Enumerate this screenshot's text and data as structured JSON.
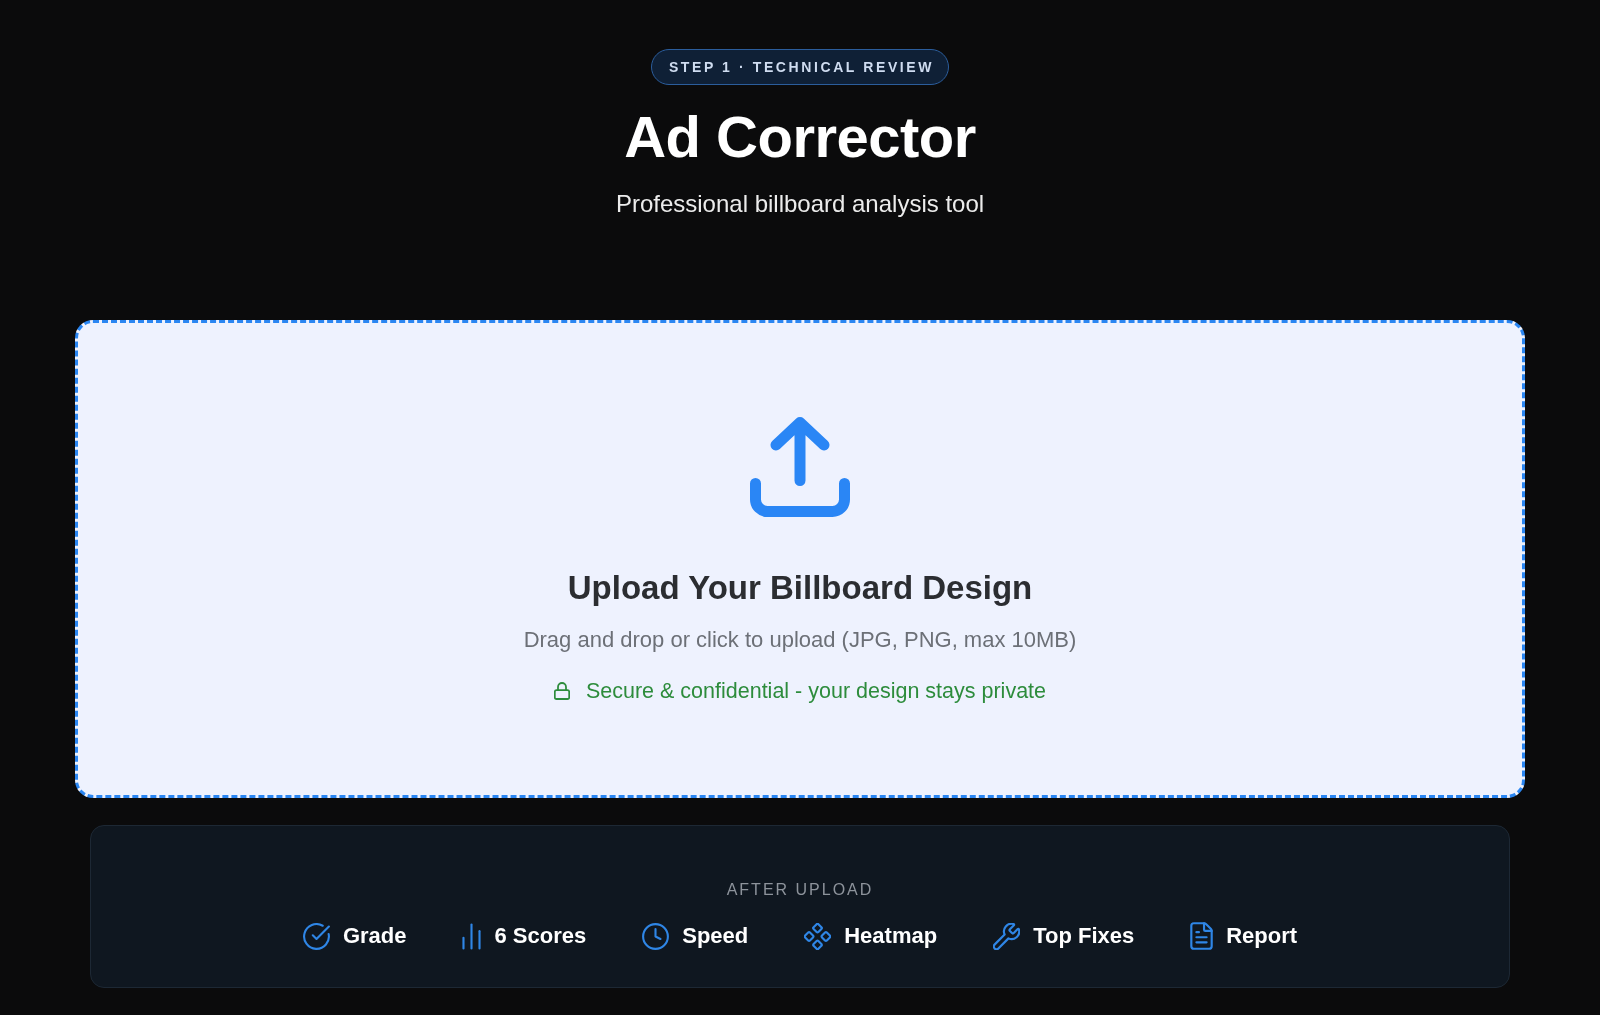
{
  "badge": "STEP 1 · TECHNICAL REVIEW",
  "title": "Ad Corrector",
  "subtitle": "Professional billboard analysis tool",
  "upload_zone": {
    "heading": "Upload Your Billboard Design",
    "hint": "Drag and drop or click to upload (JPG, PNG, max 10MB)",
    "privacy_note": "Secure & confidential - your design stays private"
  },
  "after_upload": {
    "label": "AFTER UPLOAD",
    "features": [
      "Grade",
      "6 Scores",
      "Speed",
      "Heatmap",
      "Top Fixes",
      "Report"
    ]
  }
}
